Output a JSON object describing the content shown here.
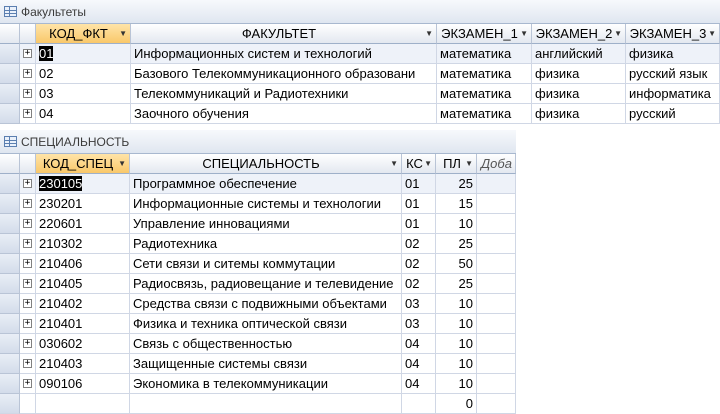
{
  "faculties": {
    "title": "Факультеты",
    "headers": {
      "code": "КОД_ФКТ",
      "name": "ФАКУЛЬТЕТ",
      "exam1": "ЭКЗАМЕН_1",
      "exam2": "ЭКЗАМЕН_2",
      "exam3": "ЭКЗАМЕН_3"
    },
    "rows": [
      {
        "code": "01",
        "name": "Информационных систем и технологий",
        "exam1": "математика",
        "exam2": "английский",
        "exam3": "физика"
      },
      {
        "code": "02",
        "name": "Базового Телекоммуникационного образовани",
        "exam1": "математика",
        "exam2": "физика",
        "exam3": "русский язык"
      },
      {
        "code": "03",
        "name": "Телекоммуникаций и Радиотехники",
        "exam1": "математика",
        "exam2": "физика",
        "exam3": "информатика"
      },
      {
        "code": "04",
        "name": "Заочного обучения",
        "exam1": "математика",
        "exam2": "физика",
        "exam3": "русский"
      }
    ]
  },
  "specialties": {
    "title": "СПЕЦИАЛЬНОСТЬ",
    "headers": {
      "code": "КОД_СПЕЦ",
      "name": "СПЕЦИАЛЬНОСТЬ",
      "fct": "КС",
      "plan": "ПЛ",
      "add": "Доба"
    },
    "rows": [
      {
        "code": "230105",
        "name": "Программное обеспечение",
        "fct": "01",
        "plan": "25"
      },
      {
        "code": "230201",
        "name": "Информационные системы и технологии",
        "fct": "01",
        "plan": "15"
      },
      {
        "code": "220601",
        "name": "Управление инновациями",
        "fct": "01",
        "plan": "10"
      },
      {
        "code": "210302",
        "name": "Радиотехника",
        "fct": "02",
        "plan": "25"
      },
      {
        "code": "210406",
        "name": "Сети связи и ситемы коммутации",
        "fct": "02",
        "plan": "50"
      },
      {
        "code": "210405",
        "name": "Радиосвязь, радиовещание и телевидение",
        "fct": "02",
        "plan": "25"
      },
      {
        "code": "210402",
        "name": "Средства связи с подвижными объектами",
        "fct": "03",
        "plan": "10"
      },
      {
        "code": "210401",
        "name": "Физика и техника оптической связи",
        "fct": "03",
        "plan": "10"
      },
      {
        "code": "030602",
        "name": "Связь с общественностью",
        "fct": "04",
        "plan": "10"
      },
      {
        "code": "210403",
        "name": "Защищенные системы связи",
        "fct": "04",
        "plan": "10"
      },
      {
        "code": "090106",
        "name": "Экономика в телекоммуникации",
        "fct": "04",
        "plan": "10"
      }
    ],
    "new_row_plan": "0"
  }
}
